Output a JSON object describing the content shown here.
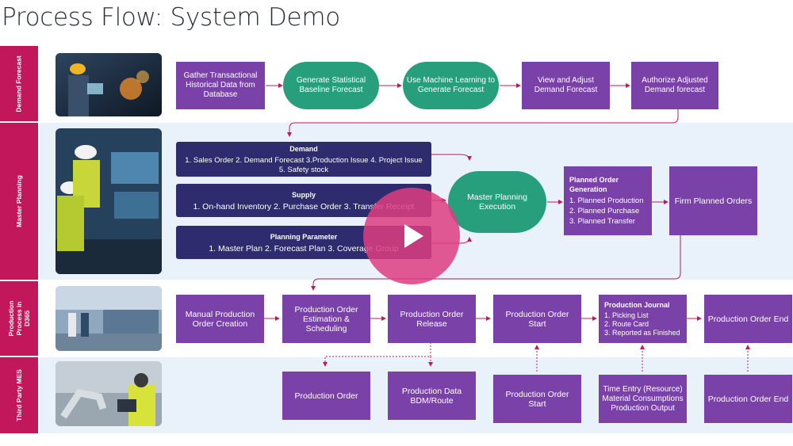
{
  "title": "Process Flow: System Demo",
  "colors": {
    "lane_label": "#c2185b",
    "lane_bg": "#e9f2fa",
    "process": "#7a42a8",
    "rounded": "#279e7c",
    "input": "#2e2b6e",
    "arrow": "#c2185b",
    "play": "#dd3d80"
  },
  "lanes": [
    "Demand Forecast",
    "Master Planning",
    "Production Process in D365",
    "Third Party MES"
  ],
  "demand_forecast": {
    "gather": "Gather Transactional Historical Data from Database",
    "generate": "Generate Statistical Baseline Forecast",
    "ml": "Use Machine Learning to Generate Forecast",
    "view": "View and Adjust Demand Forecast",
    "authorize": "Authorize Adjusted Demand forecast"
  },
  "master_planning": {
    "demand": {
      "title": "Demand",
      "body": "1. Sales Order  2. Demand Forecast  3.Production Issue  4. Project Issue  5. Safety stock"
    },
    "supply": {
      "title": "Supply",
      "body": "1. On-hand Inventory  2. Purchase Order  3. Transfer Receipt"
    },
    "parameter": {
      "title": "Planning Parameter",
      "body": "1. Master Plan  2. Forecast Plan  3. Coverage Group"
    },
    "execution": "Master Planning Execution",
    "planned_order": {
      "title": "Planned Order Generation",
      "items": [
        "1. Planned Production",
        "2. Planned Purchase",
        "3. Planned Transfer"
      ]
    },
    "firm": "Firm Planned Orders"
  },
  "production": {
    "manual": "Manual Production Order Creation",
    "estimation": "Production Order Estimation & Scheduling",
    "release": "Production Order Release",
    "start": "Production Order Start",
    "journal": {
      "title": "Production Journal",
      "items": [
        "1. Picking List",
        "2. Route Card",
        "3. Reported as Finished"
      ]
    },
    "end": "Production Order End"
  },
  "mes": {
    "order": "Production Order",
    "bdm": "Production Data BDM/Route",
    "start": "Production Order Start",
    "time": "Time Entry (Resource) Material Consumptions Production Output",
    "end": "Production Order End"
  },
  "icons": {
    "play": "play-icon"
  }
}
